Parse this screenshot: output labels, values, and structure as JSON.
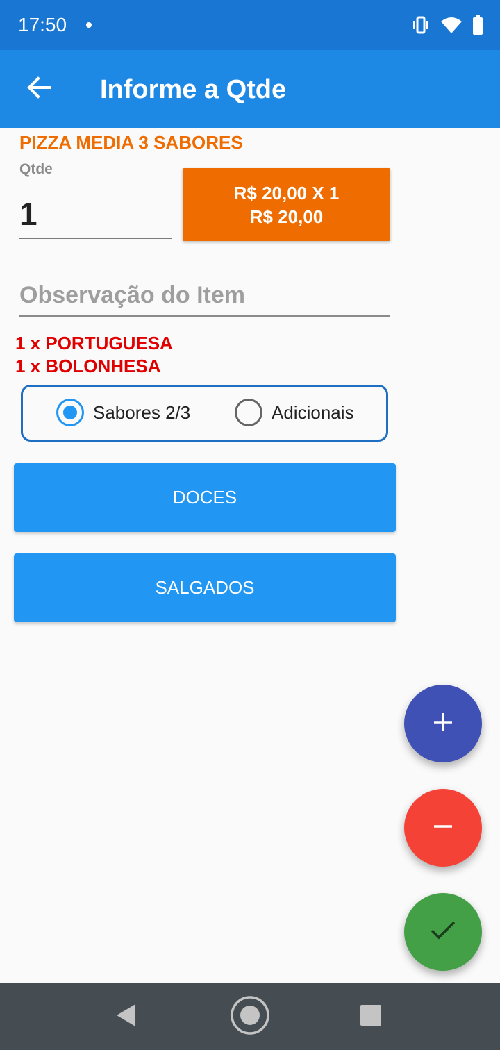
{
  "status_bar": {
    "time": "17:50",
    "icons": [
      "vibrate-icon",
      "wifi-icon",
      "battery-icon"
    ]
  },
  "app_bar": {
    "title": "Informe a Qtde",
    "back_icon": "arrow-back-icon"
  },
  "item": {
    "product_name": "PIZZA MEDIA 3 SABORES",
    "qty_label": "Qtde",
    "qty_value": "1",
    "price_line1": "R$ 20,00 X 1",
    "price_line2": "R$ 20,00",
    "observation_placeholder": "Observação do Item",
    "observation_value": "",
    "flavors": [
      "1 x PORTUGUESA",
      "1 x BOLONHESA"
    ]
  },
  "options": {
    "radio1_label": "Sabores 2/3",
    "radio2_label": "Adicionais",
    "selected": "Sabores 2/3"
  },
  "categories": [
    "DOCES",
    "SALGADOS"
  ],
  "fabs": {
    "add_icon": "plus-icon",
    "remove_icon": "minus-icon",
    "confirm_icon": "check-icon"
  },
  "nav": {
    "icons": [
      "nav-back-icon",
      "nav-home-icon",
      "nav-recents-icon"
    ]
  },
  "colors": {
    "status_bar": "#1976d2",
    "app_bar": "#1e88e5",
    "accent_orange": "#ef6c00",
    "flavor_red": "#e00000",
    "button_blue": "#2196f3",
    "fab_add": "#3f51b5",
    "fab_remove": "#f44336",
    "fab_confirm": "#43a047",
    "nav_bar": "#454c52"
  }
}
